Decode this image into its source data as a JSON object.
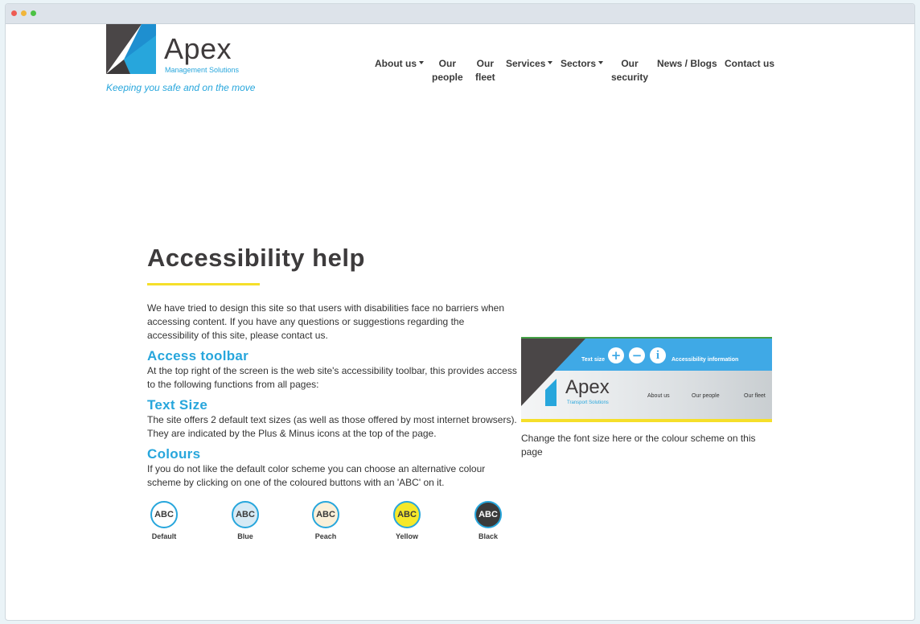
{
  "site": {
    "brand": "Apex",
    "brand_sub": "Management Solutions",
    "tagline": "Keeping you safe and on the move"
  },
  "nav": {
    "items": [
      {
        "label": "About us",
        "dropdown": true
      },
      {
        "line1": "Our",
        "line2": "people"
      },
      {
        "line1": "Our",
        "line2": "fleet"
      },
      {
        "label": "Services",
        "dropdown": true
      },
      {
        "label": "Sectors",
        "dropdown": true
      },
      {
        "line1": "Our",
        "line2": "security"
      },
      {
        "label": "News / Blogs"
      },
      {
        "label": "Contact us"
      }
    ]
  },
  "main": {
    "title": "Accessibility help",
    "intro": "We have tried to design this site so that users with disabilities face no barriers when accessing content. If you have any questions or suggestions regarding the accessibility of this site, please contact us.",
    "sections": [
      {
        "heading": "Access toolbar",
        "body": "At the top right of the screen is the web site's accessibility toolbar, this provides access to the following functions from all pages:"
      },
      {
        "heading": "Text Size",
        "body": "The site offers 2 default text sizes (as well as those offered by most internet browsers). They are indicated by the Plus & Minus icons at the top of the page."
      },
      {
        "heading": "Colours",
        "body": "If you do not like the default color scheme you can choose an alternative colour scheme by clicking on one of the coloured buttons with an 'ABC' on it."
      }
    ],
    "swatches": [
      {
        "text": "ABC",
        "label": "Default",
        "bg": "#ffffff",
        "fg": "#3a3a3a"
      },
      {
        "text": "ABC",
        "label": "Blue",
        "bg": "#d6eaf5",
        "fg": "#3a3a3a"
      },
      {
        "text": "ABC",
        "label": "Peach",
        "bg": "#fbf0d9",
        "fg": "#3a3a3a"
      },
      {
        "text": "ABC",
        "label": "Yellow",
        "bg": "#f5e82a",
        "fg": "#3a3a3a"
      },
      {
        "text": "ABC",
        "label": "Black",
        "bg": "#3a3a3a",
        "fg": "#ffffff"
      }
    ]
  },
  "preview": {
    "text_size": "Text size",
    "plus": "+",
    "minus": "−",
    "info": "i",
    "accessibility": "Accessibility information",
    "brand": "Apex",
    "brand_sub": "Transport Solutions",
    "nav": [
      "About us",
      "Our people",
      "Our fleet"
    ],
    "caption": "Change the font size here or the colour scheme on this page"
  },
  "colors": {
    "accent": "#27a6dc",
    "underline": "#f5df2a",
    "text": "#333333"
  }
}
